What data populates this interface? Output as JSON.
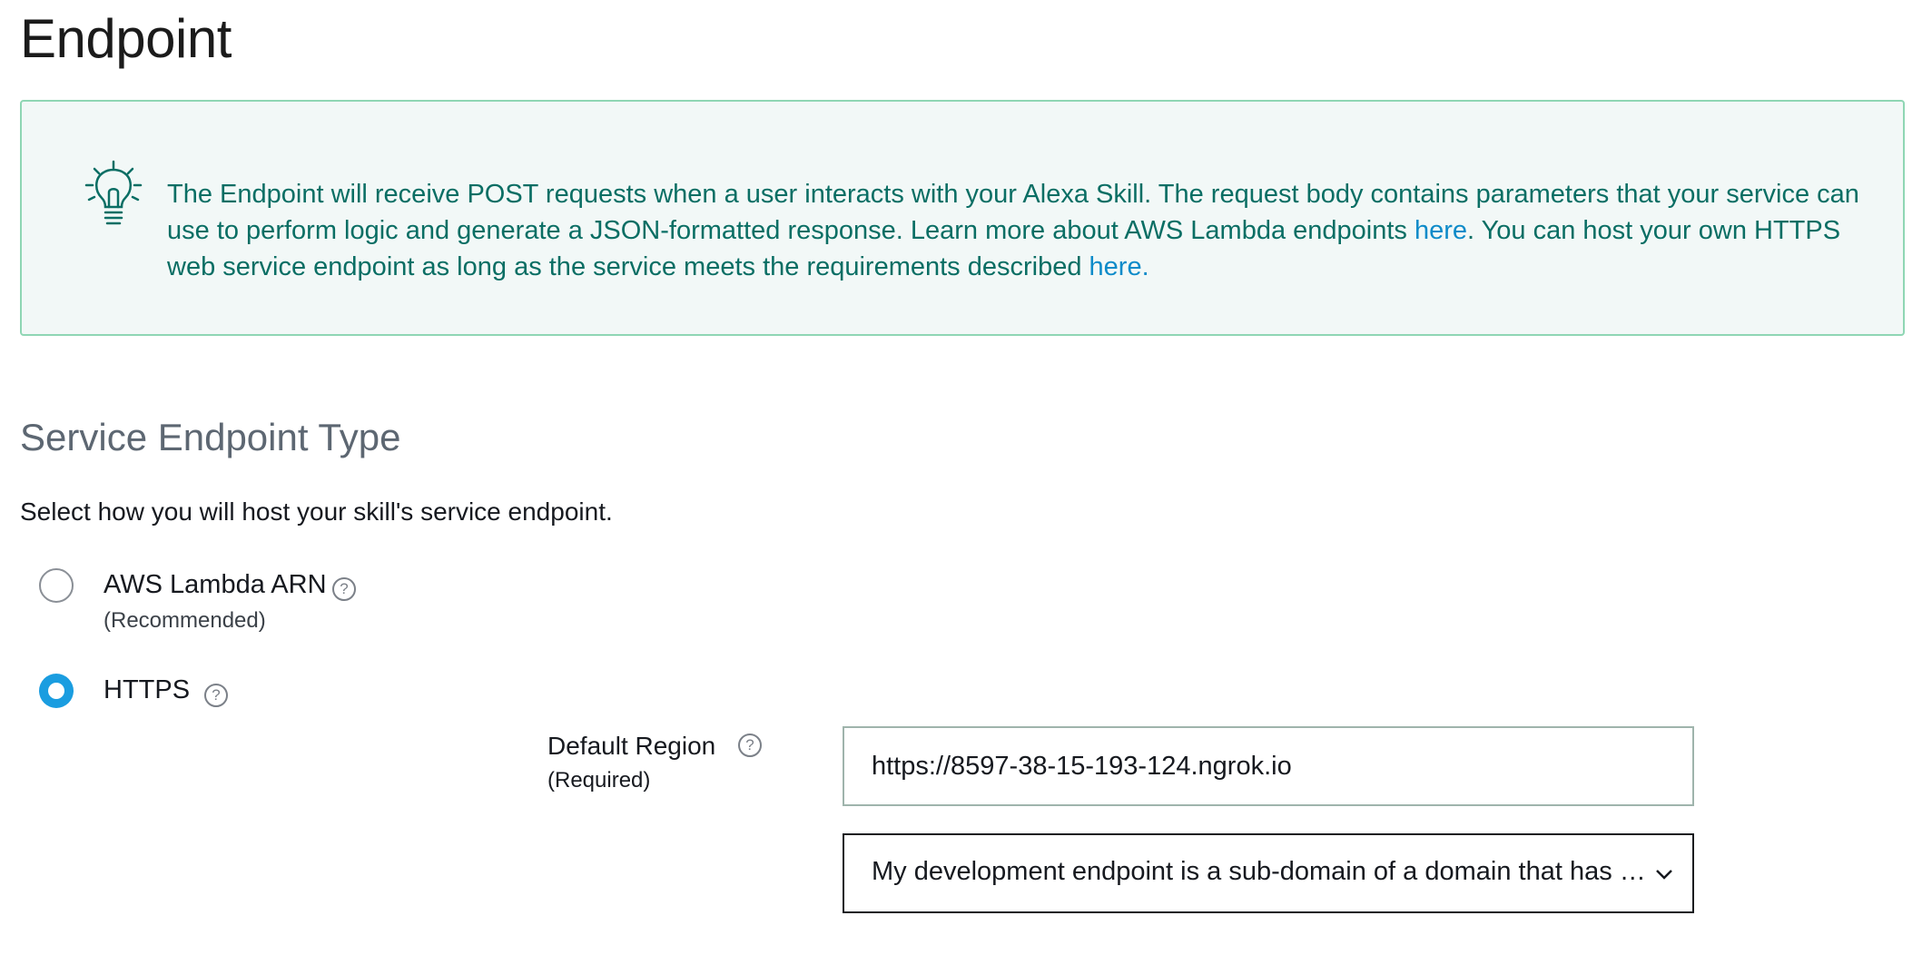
{
  "page": {
    "title": "Endpoint"
  },
  "info": {
    "text_1": "The Endpoint will receive POST requests when a user interacts with your Alexa Skill. The request body contains parameters that your service can use to perform logic and generate a JSON-formatted response. Learn more about AWS Lambda endpoints ",
    "link_1": "here",
    "text_2": ". You can host your own HTTPS web service endpoint as long as the service meets the requirements described ",
    "link_2": "here.",
    "icon": "lightbulb-icon",
    "text_color": "#0a6e64",
    "link_color": "#0d8bc9"
  },
  "section": {
    "title": "Service Endpoint Type",
    "description": "Select how you will host your skill's service endpoint."
  },
  "options": {
    "lambda": {
      "label": "AWS Lambda ARN",
      "sub": "(Recommended)",
      "selected": false
    },
    "https": {
      "label": "HTTPS",
      "selected": true
    }
  },
  "help_glyph": "?",
  "region": {
    "label": "Default Region",
    "sub": "(Required)",
    "url_value": "https://8597-38-15-193-124.ngrok.io",
    "cert_option": "My development endpoint is a sub-domain of a domain that has a wildcard certificate from a certificate authority"
  },
  "colors": {
    "accent": "#1a9de0",
    "info_border": "#8fd6b4",
    "info_bg": "#f2f8f7"
  }
}
